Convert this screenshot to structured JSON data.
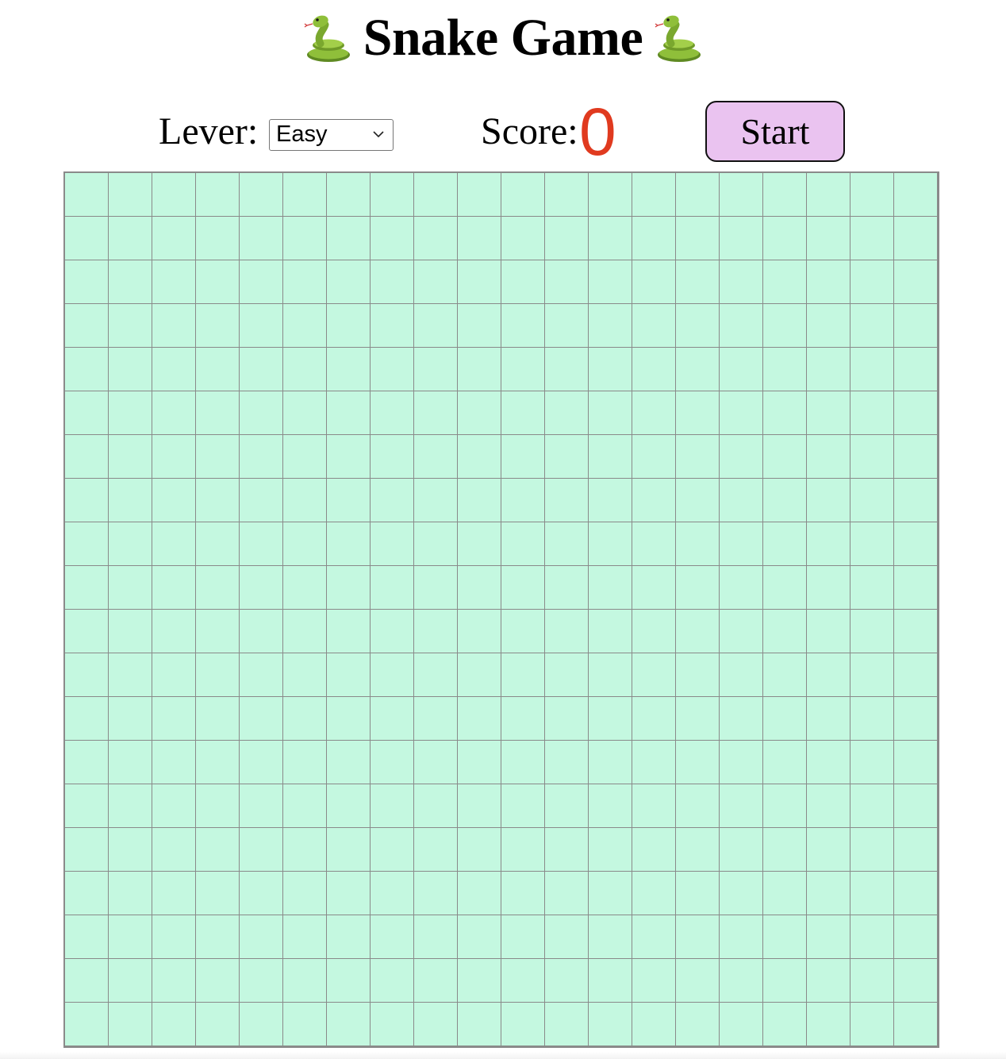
{
  "header": {
    "title": "Snake Game",
    "icon_left": "snake-emoji-icon",
    "icon_right": "snake-emoji-icon"
  },
  "controls": {
    "level_label": "Lever:",
    "level_selected": "Easy",
    "score_label": "Score:",
    "score_value": "0",
    "start_label": "Start"
  },
  "board": {
    "columns": 20,
    "rows": 20
  },
  "colors": {
    "board_background": "#c4f8e0",
    "grid_line": "#8a8a8a",
    "score_color": "#e03a1f",
    "start_button_background": "#eac3f0"
  }
}
